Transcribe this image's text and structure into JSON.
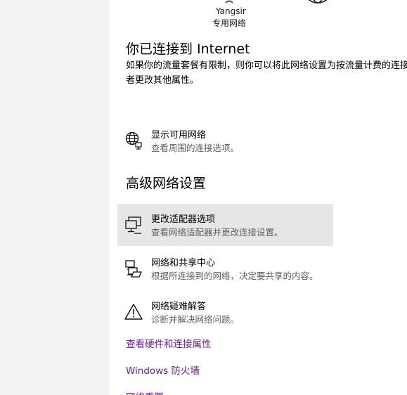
{
  "network": {
    "name": "Yangsir",
    "status": "专用网络"
  },
  "connection": {
    "title": "你已连接到 Internet",
    "description": "如果你的流量套餐有限制，则你可以将此网络设置为按流量计费的连接，或者更改其他属性。"
  },
  "show_networks": {
    "label": "显示可用网络",
    "sub": "查看周围的连接选项。",
    "icon": "globe-network-icon"
  },
  "advanced": {
    "title": "高级网络设置",
    "items": [
      {
        "label": "更改适配器选项",
        "sub": "查看网络适配器并更改连接设置。",
        "icon": "adapter-monitor-icon"
      },
      {
        "label": "网络和共享中心",
        "sub": "根据所连接到的网络，决定要共享的内容。",
        "icon": "sharing-center-icon"
      },
      {
        "label": "网络疑难解答",
        "sub": "诊断并解决网络问题。",
        "icon": "warning-icon"
      }
    ]
  },
  "links": {
    "hardware": "查看硬件和连接属性",
    "firewall": "Windows 防火墙",
    "reset": "网络重置"
  },
  "colors": {
    "link": "#6a1b9a",
    "highlight": "#e6e6e6",
    "left_pane": "#f2f2f2"
  }
}
